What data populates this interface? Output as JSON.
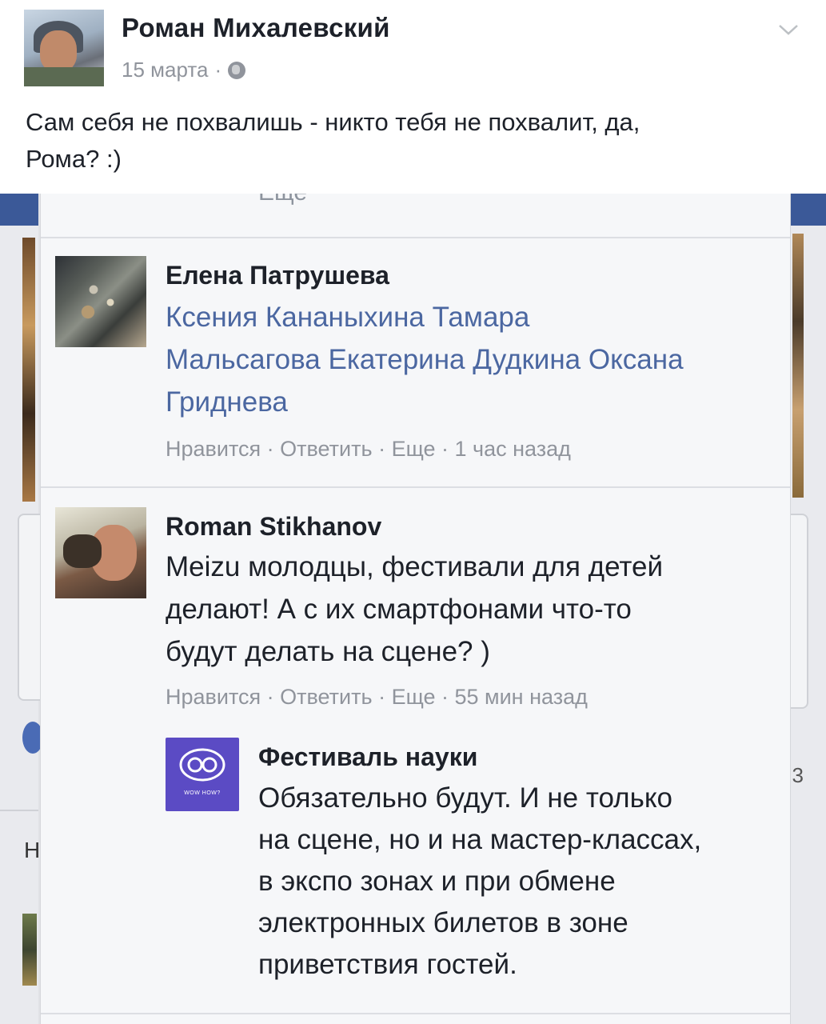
{
  "post": {
    "author": "Роман Михалевский",
    "date": "15 марта",
    "meta_separator": "·",
    "text_line1": "Сам себя не похвалишь - никто тебя не похвалит, да,",
    "text_line2": "Рома? :)",
    "icons": {
      "privacy": "globe-icon",
      "menu": "chevron-down-icon"
    }
  },
  "embed": {
    "more_partial": "Еще",
    "side_letter_left": "Н",
    "side_letter_right": "3",
    "comments": [
      {
        "name": "Елена Патрушева",
        "text_lines": [
          "Ксения Кананыхина Тамара",
          "Мальсагова Екатерина Дудкина Оксана",
          "Гриднева"
        ],
        "like": "Нравится",
        "reply": "Ответить",
        "more": "Еще",
        "sep": " · ",
        "time": "1 час назад"
      },
      {
        "name": "Roman Stikhanov",
        "text_lines": [
          "Meizu молодцы, фестивали для детей",
          "делают! А с их смартфонами что-то",
          "будут делать на сцене? )"
        ],
        "like": "Нравится",
        "reply": "Ответить",
        "more": "Еще",
        "sep": " · ",
        "time": "55 мин назад"
      },
      {
        "name": "Фестиваль науки",
        "logo_text": "WOW HOW?",
        "text_lines": [
          "Обязательно будут. И не только",
          "на сцене, но и на мастер-классах,",
          "в экспо зонах и при обмене",
          "электронных билетов в зоне",
          "приветствия гостей."
        ]
      }
    ]
  },
  "colors": {
    "text": "#1d2129",
    "meta": "#90949c",
    "link_names": "#4b67a1",
    "facebook_blue": "#3b5998",
    "festival_purple": "#5b4bc4"
  }
}
